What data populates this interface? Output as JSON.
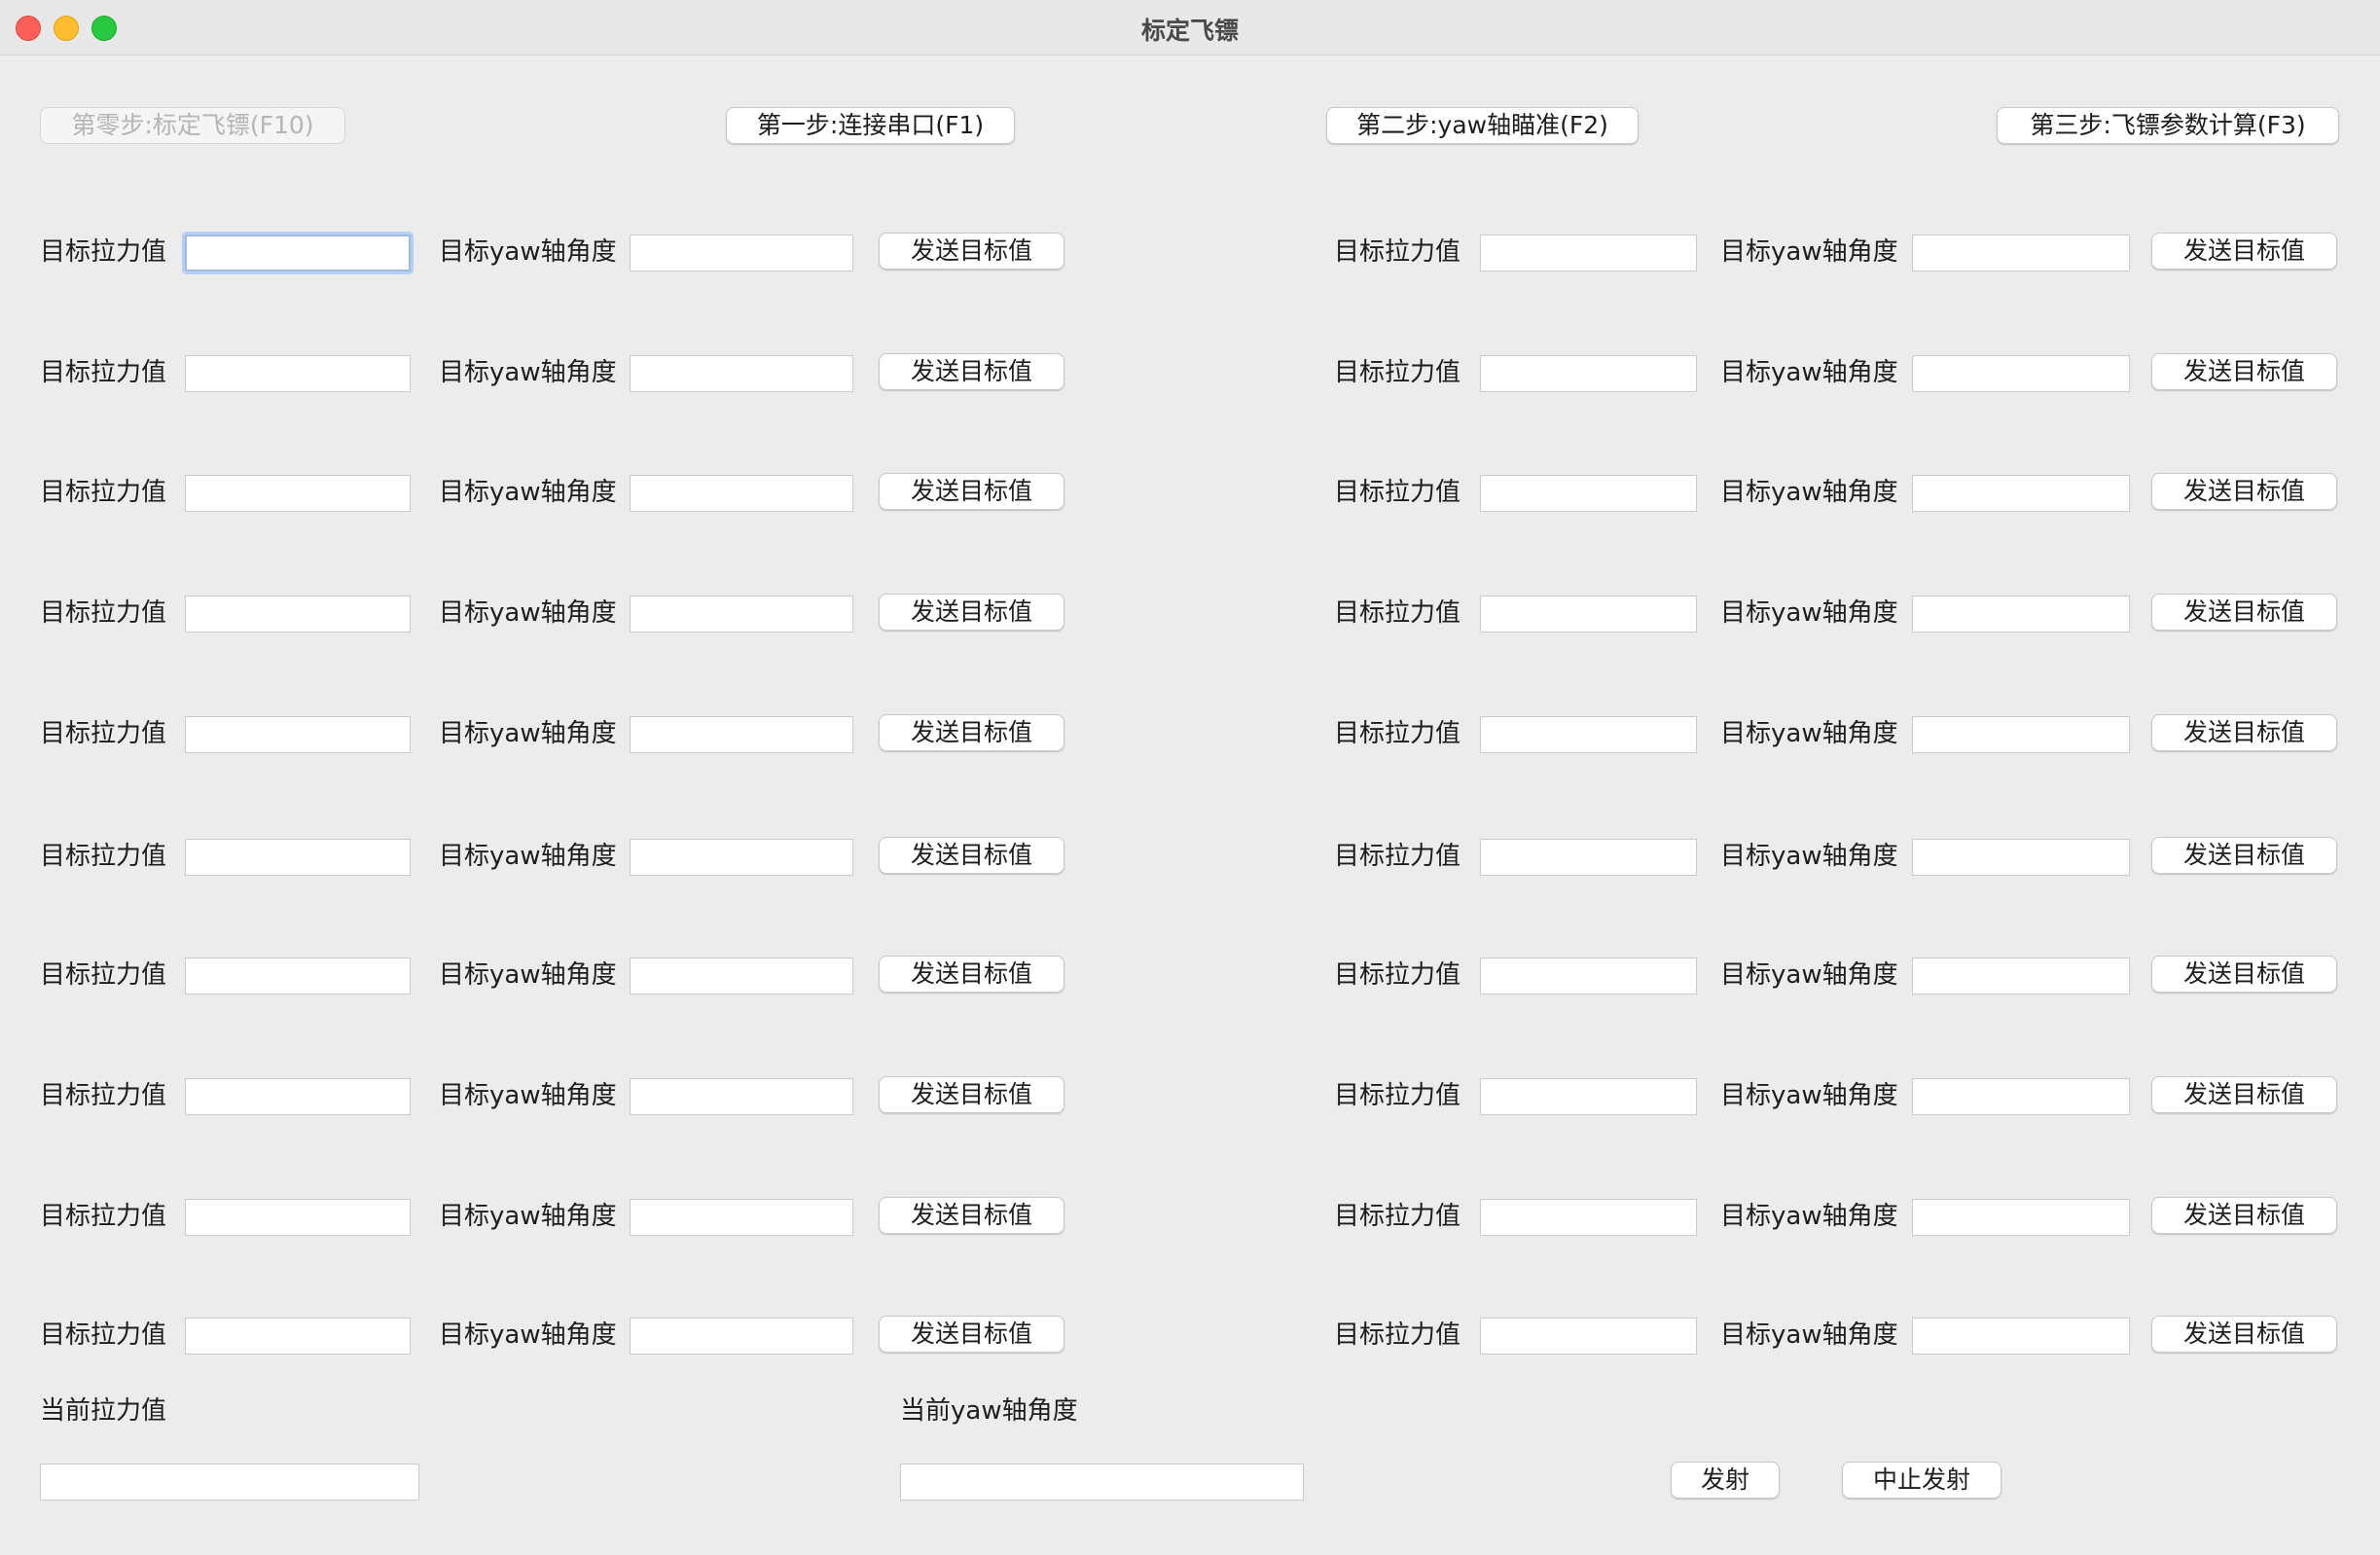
{
  "window": {
    "title": "标定飞镖"
  },
  "steps": {
    "step0": "第零步:标定飞镖(F10)",
    "step1": "第一步:连接串口(F1)",
    "step2": "第二步:yaw轴瞄准(F2)",
    "step3": "第三步:飞镖参数计算(F3)"
  },
  "rows": [
    {
      "left": {
        "force_label": "目标拉力值",
        "force_value": "",
        "yaw_label": "目标yaw轴角度",
        "yaw_value": "",
        "send": "发送目标值"
      },
      "right": {
        "force_label": "目标拉力值",
        "force_value": "",
        "yaw_label": "目标yaw轴角度",
        "yaw_value": "",
        "send": "发送目标值"
      }
    },
    {
      "left": {
        "force_label": "目标拉力值",
        "force_value": "",
        "yaw_label": "目标yaw轴角度",
        "yaw_value": "",
        "send": "发送目标值"
      },
      "right": {
        "force_label": "目标拉力值",
        "force_value": "",
        "yaw_label": "目标yaw轴角度",
        "yaw_value": "",
        "send": "发送目标值"
      }
    },
    {
      "left": {
        "force_label": "目标拉力值",
        "force_value": "",
        "yaw_label": "目标yaw轴角度",
        "yaw_value": "",
        "send": "发送目标值"
      },
      "right": {
        "force_label": "目标拉力值",
        "force_value": "",
        "yaw_label": "目标yaw轴角度",
        "yaw_value": "",
        "send": "发送目标值"
      }
    },
    {
      "left": {
        "force_label": "目标拉力值",
        "force_value": "",
        "yaw_label": "目标yaw轴角度",
        "yaw_value": "",
        "send": "发送目标值"
      },
      "right": {
        "force_label": "目标拉力值",
        "force_value": "",
        "yaw_label": "目标yaw轴角度",
        "yaw_value": "",
        "send": "发送目标值"
      }
    },
    {
      "left": {
        "force_label": "目标拉力值",
        "force_value": "",
        "yaw_label": "目标yaw轴角度",
        "yaw_value": "",
        "send": "发送目标值"
      },
      "right": {
        "force_label": "目标拉力值",
        "force_value": "",
        "yaw_label": "目标yaw轴角度",
        "yaw_value": "",
        "send": "发送目标值"
      }
    },
    {
      "left": {
        "force_label": "目标拉力值",
        "force_value": "",
        "yaw_label": "目标yaw轴角度",
        "yaw_value": "",
        "send": "发送目标值"
      },
      "right": {
        "force_label": "目标拉力值",
        "force_value": "",
        "yaw_label": "目标yaw轴角度",
        "yaw_value": "",
        "send": "发送目标值"
      }
    },
    {
      "left": {
        "force_label": "目标拉力值",
        "force_value": "",
        "yaw_label": "目标yaw轴角度",
        "yaw_value": "",
        "send": "发送目标值"
      },
      "right": {
        "force_label": "目标拉力值",
        "force_value": "",
        "yaw_label": "目标yaw轴角度",
        "yaw_value": "",
        "send": "发送目标值"
      }
    },
    {
      "left": {
        "force_label": "目标拉力值",
        "force_value": "",
        "yaw_label": "目标yaw轴角度",
        "yaw_value": "",
        "send": "发送目标值"
      },
      "right": {
        "force_label": "目标拉力值",
        "force_value": "",
        "yaw_label": "目标yaw轴角度",
        "yaw_value": "",
        "send": "发送目标值"
      }
    },
    {
      "left": {
        "force_label": "目标拉力值",
        "force_value": "",
        "yaw_label": "目标yaw轴角度",
        "yaw_value": "",
        "send": "发送目标值"
      },
      "right": {
        "force_label": "目标拉力值",
        "force_value": "",
        "yaw_label": "目标yaw轴角度",
        "yaw_value": "",
        "send": "发送目标值"
      }
    },
    {
      "left": {
        "force_label": "目标拉力值",
        "force_value": "",
        "yaw_label": "目标yaw轴角度",
        "yaw_value": "",
        "send": "发送目标值"
      },
      "right": {
        "force_label": "目标拉力值",
        "force_value": "",
        "yaw_label": "目标yaw轴角度",
        "yaw_value": "",
        "send": "发送目标值"
      }
    }
  ],
  "status": {
    "current_force_label": "当前拉力值",
    "current_force_value": "",
    "current_yaw_label": "当前yaw轴角度",
    "current_yaw_value": "",
    "fire_button": "发射",
    "abort_button": "中止发射"
  }
}
